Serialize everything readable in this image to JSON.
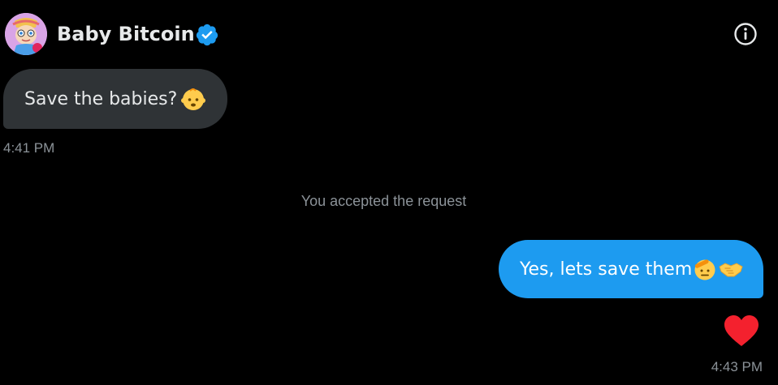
{
  "header": {
    "name": "Baby Bitcoin",
    "verified_icon": "verified-badge-icon",
    "info_icon": "info-icon"
  },
  "messages": [
    {
      "direction": "incoming",
      "text": "Save the babies? ",
      "emoji": "baby-face-emoji",
      "time": "4:41 PM"
    },
    {
      "direction": "system",
      "text": "You accepted the request"
    },
    {
      "direction": "outgoing",
      "text": "Yes, lets save them",
      "emojis": [
        "saluting-face-emoji",
        "handshake-emoji"
      ],
      "reaction": "red-heart-icon",
      "time": "4:43 PM"
    }
  ],
  "colors": {
    "background": "#000000",
    "incoming_bubble": "#2f3336",
    "outgoing_bubble": "#1d9bf0",
    "verified": "#1d9bf0",
    "heart": "#f4212e",
    "muted_text": "#8b9298"
  }
}
